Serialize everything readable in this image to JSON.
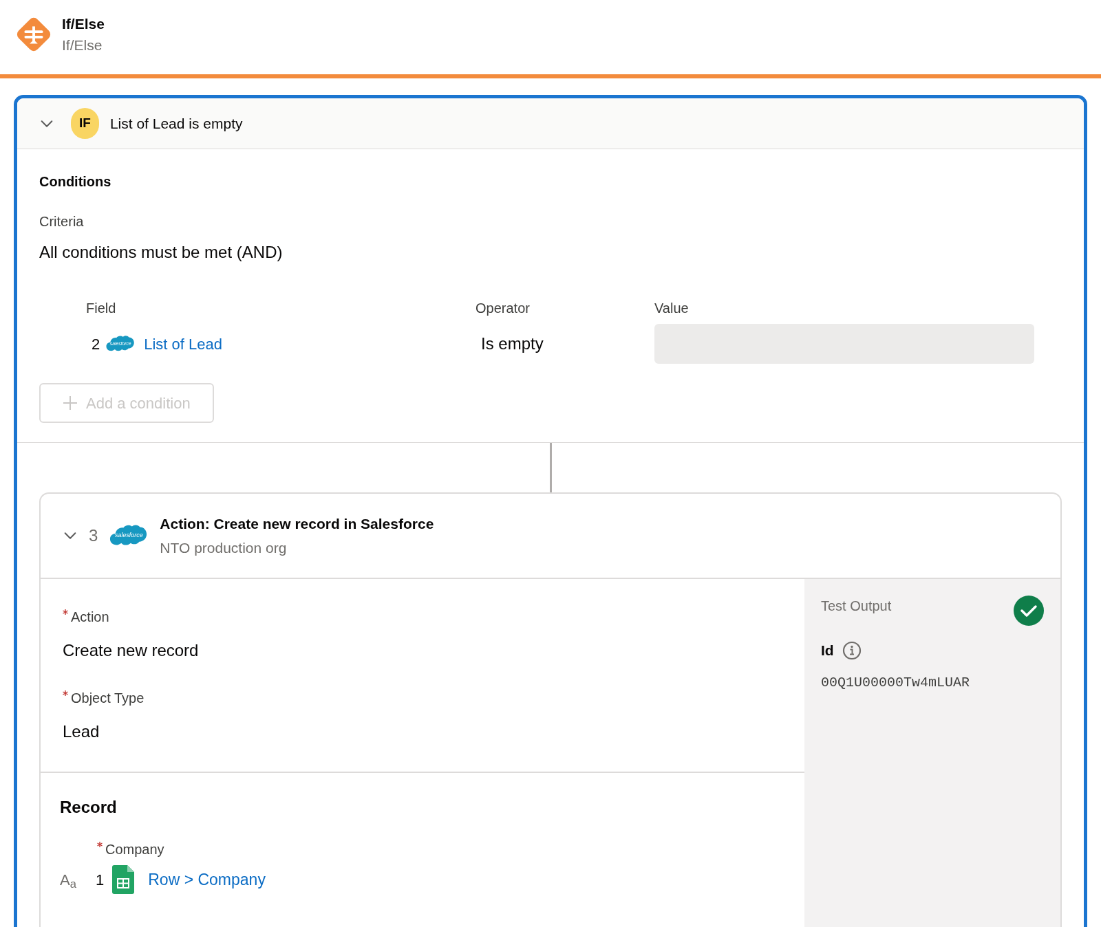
{
  "header": {
    "title": "If/Else",
    "subtitle": "If/Else"
  },
  "branch": {
    "expanded": true,
    "badge": "IF",
    "summary": "List of Lead is empty",
    "conditions": {
      "heading": "Conditions",
      "criteria_label": "Criteria",
      "criteria_value": "All conditions must be met (AND)",
      "columns": [
        "Field",
        "Operator",
        "Value"
      ],
      "rows": [
        {
          "step": "2",
          "logo_text": "salesforce",
          "field": "List of Lead",
          "operator": "Is empty"
        }
      ],
      "add_button": {
        "label": "Add a condition",
        "disabled": true
      }
    }
  },
  "step": {
    "expanded": true,
    "number": "3",
    "logo_text": "salesforce",
    "title": "Action: Create new record in Salesforce",
    "subtitle": "NTO production org",
    "fields": [
      {
        "label": "Action",
        "required": true,
        "value": "Create new record"
      },
      {
        "label": "Object Type",
        "required": true,
        "value": "Lead"
      }
    ],
    "record": {
      "heading": "Record",
      "fields": [
        {
          "label": "Company",
          "required": true,
          "type_glyph": "A$_{a}$",
          "step": "1",
          "value": "Row > Company"
        }
      ]
    },
    "test_output": {
      "title": "Test Output",
      "passed": true,
      "field_label": "Id",
      "field_value": "00Q1U00000Tw4mLUAR"
    }
  }
}
